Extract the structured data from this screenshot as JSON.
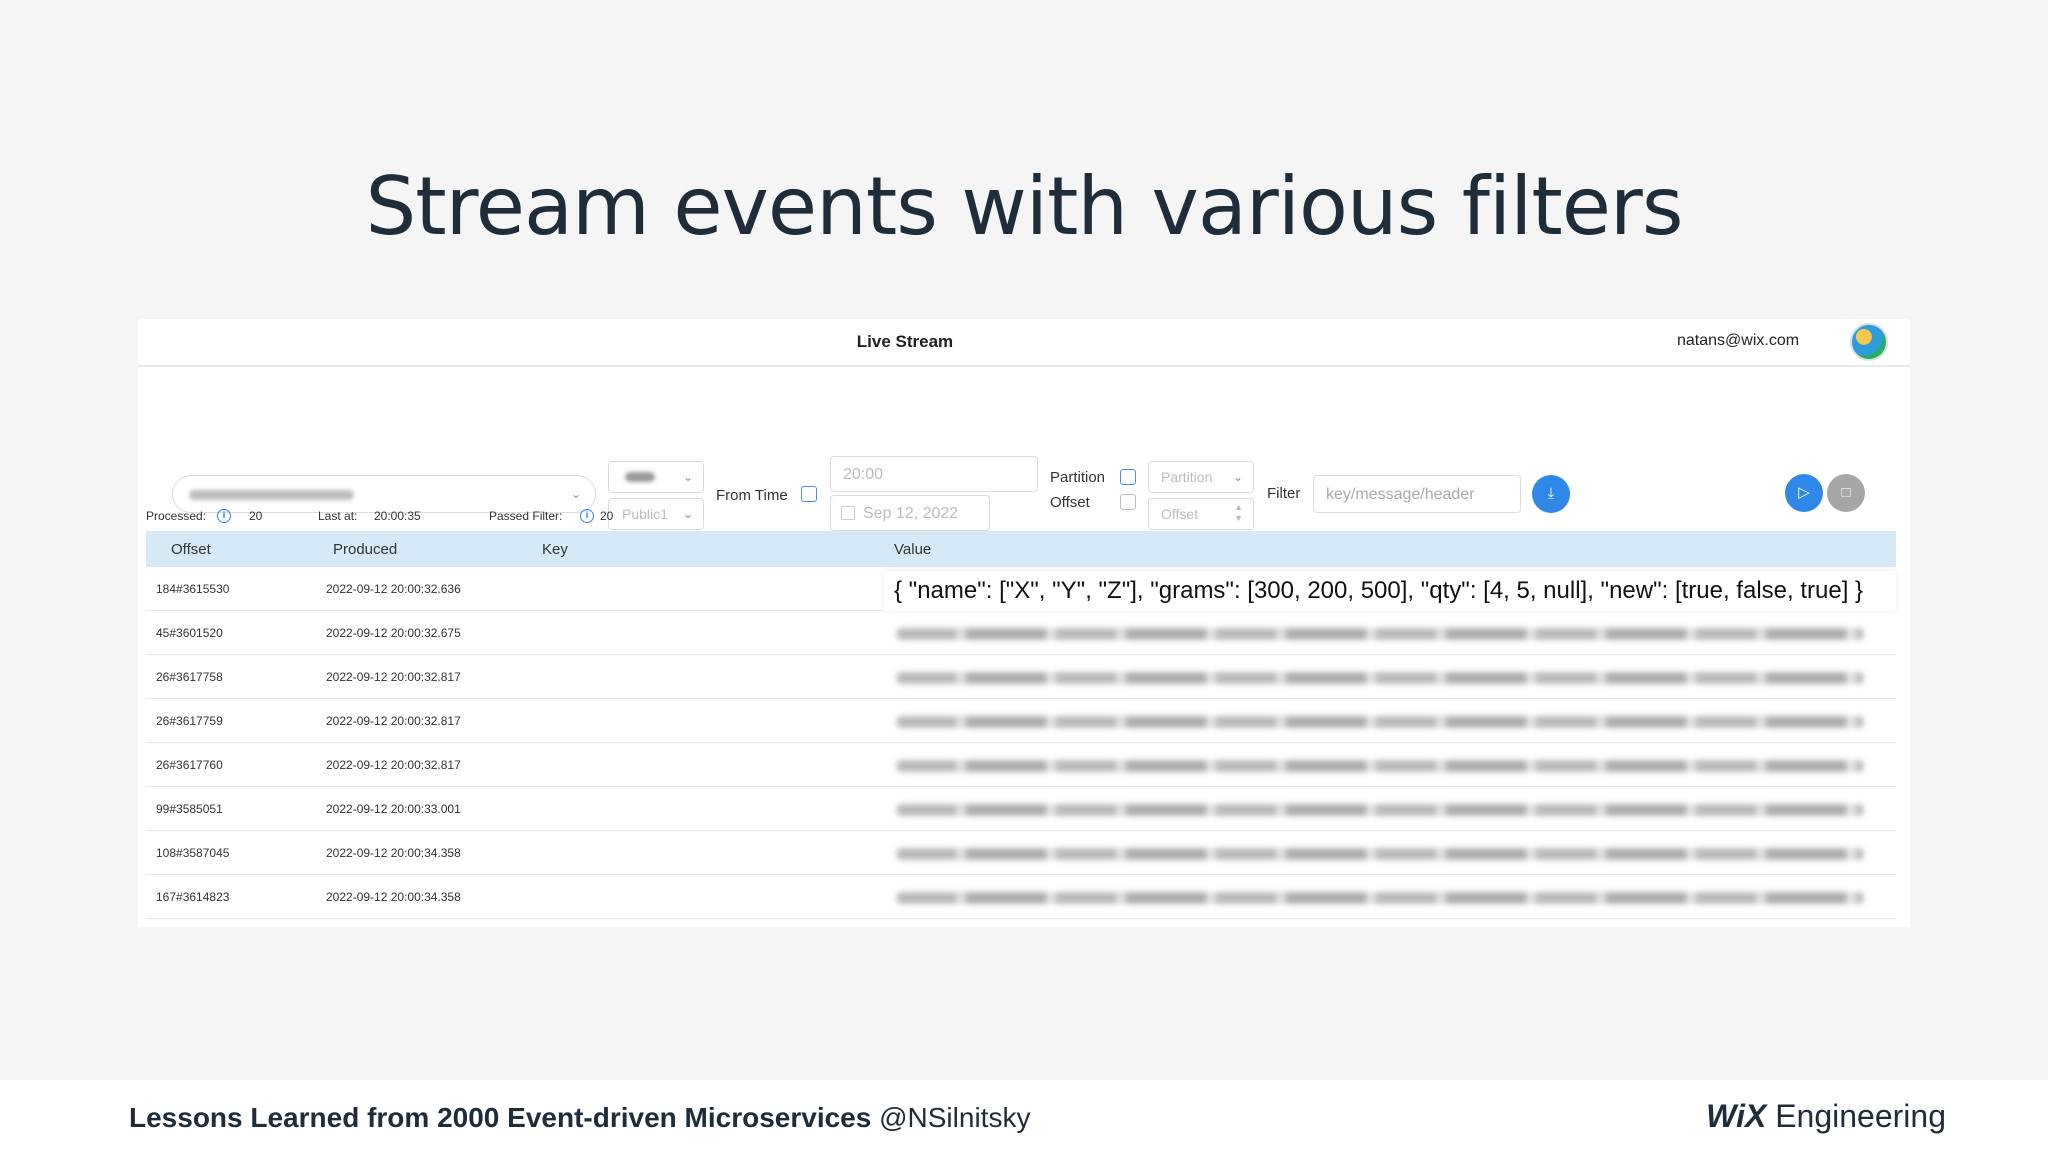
{
  "slide": {
    "title": "Stream events with various filters",
    "footer_title": "Lessons Learned from 2000 Event-driven Microservices",
    "footer_handle": "@NSilnitsky",
    "brand_bold": "WiX",
    "brand_rest": "Engineering"
  },
  "app": {
    "title": "Live Stream",
    "user_email": "natans@wix.com"
  },
  "controls": {
    "public_select_value": "Public1",
    "from_time_label": "From Time",
    "time_placeholder": "20:00",
    "date_placeholder": "Sep 12, 2022",
    "partition_label": "Partition",
    "offset_label": "Offset",
    "partition_placeholder": "Partition",
    "offset_placeholder": "Offset",
    "filter_label": "Filter",
    "filter_placeholder": "key/message/header"
  },
  "stats": {
    "processed_label": "Processed:",
    "processed_value": "20",
    "last_at_label": "Last at:",
    "last_at_value": "20:00:35",
    "passed_filter_label": "Passed Filter:",
    "passed_filter_value": "20"
  },
  "table": {
    "headers": [
      "Offset",
      "Produced",
      "Key",
      "Value"
    ],
    "highlighted_value": "{ \"name\": [\"X\", \"Y\", \"Z\"], \"grams\": [300, 200, 500], \"qty\": [4, 5, null], \"new\": [true, false, true] }",
    "rows": [
      {
        "offset": "184#3615530",
        "produced": "2022-09-12 20:00:32.636"
      },
      {
        "offset": "45#3601520",
        "produced": "2022-09-12 20:00:32.675"
      },
      {
        "offset": "26#3617758",
        "produced": "2022-09-12 20:00:32.817"
      },
      {
        "offset": "26#3617759",
        "produced": "2022-09-12 20:00:32.817"
      },
      {
        "offset": "26#3617760",
        "produced": "2022-09-12 20:00:32.817"
      },
      {
        "offset": "99#3585051",
        "produced": "2022-09-12 20:00:33.001"
      },
      {
        "offset": "108#3587045",
        "produced": "2022-09-12 20:00:34.358"
      },
      {
        "offset": "167#3614823",
        "produced": "2022-09-12 20:00:34.358"
      }
    ]
  },
  "icons": {
    "download": "download-icon",
    "play": "play-icon",
    "stop": "stop-icon",
    "info": "info-icon",
    "calendar": "calendar-icon",
    "chevron": "chevron-down-icon"
  },
  "colors": {
    "accent": "#2f88e8",
    "header_row": "#d5e9f7",
    "title": "#1f2d3a"
  }
}
